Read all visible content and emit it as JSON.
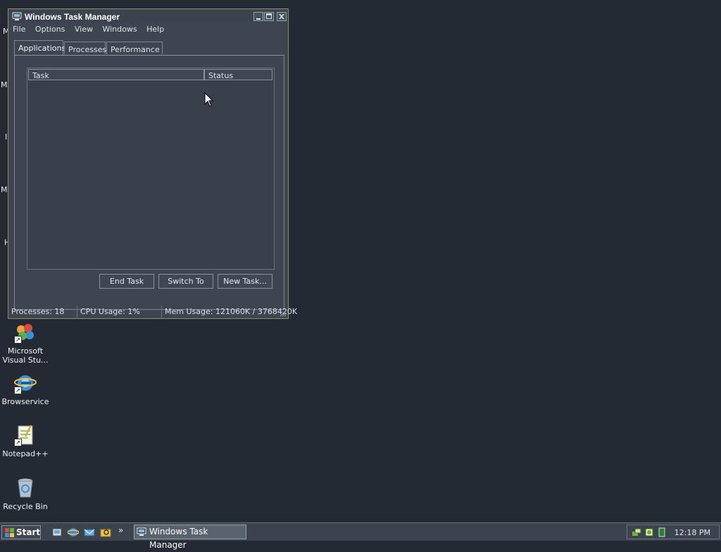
{
  "desktop": {
    "icons": [
      {
        "label": "Microsoft\nVisual Stu..."
      },
      {
        "label": "Browservice"
      },
      {
        "label": "Notepad++"
      },
      {
        "label": "Recycle Bin"
      }
    ],
    "hidden_fragments": [
      "M",
      "M",
      "I",
      "M",
      "H"
    ]
  },
  "window": {
    "title": "Windows Task Manager",
    "menu": [
      "File",
      "Options",
      "View",
      "Windows",
      "Help"
    ],
    "tabs": [
      "Applications",
      "Processes",
      "Performance"
    ],
    "active_tab": "Applications",
    "columns": [
      "Task",
      "Status"
    ],
    "rows": [],
    "buttons": {
      "end_task": "End Task",
      "switch_to": "Switch To",
      "new_task": "New Task..."
    },
    "status": {
      "processes": "Processes: 18",
      "cpu": "CPU Usage: 1%",
      "mem": "Mem Usage: 121060K / 3768420K"
    }
  },
  "taskbar": {
    "start_label": "Start",
    "quick_launch": [
      "show-desktop-icon",
      "browser-icon",
      "email-icon",
      "explorer-icon"
    ],
    "chevron": "»",
    "task_buttons": [
      "Windows Task Manager"
    ],
    "tray_icons": [
      "network-icon",
      "security-icon",
      "battery-icon"
    ],
    "clock": "12:18 PM"
  },
  "colors": {
    "desktop_bg": "#232a33",
    "window_bg": "#3c4550",
    "window_border": "#8c8e6a",
    "active_task": "#59636e"
  }
}
